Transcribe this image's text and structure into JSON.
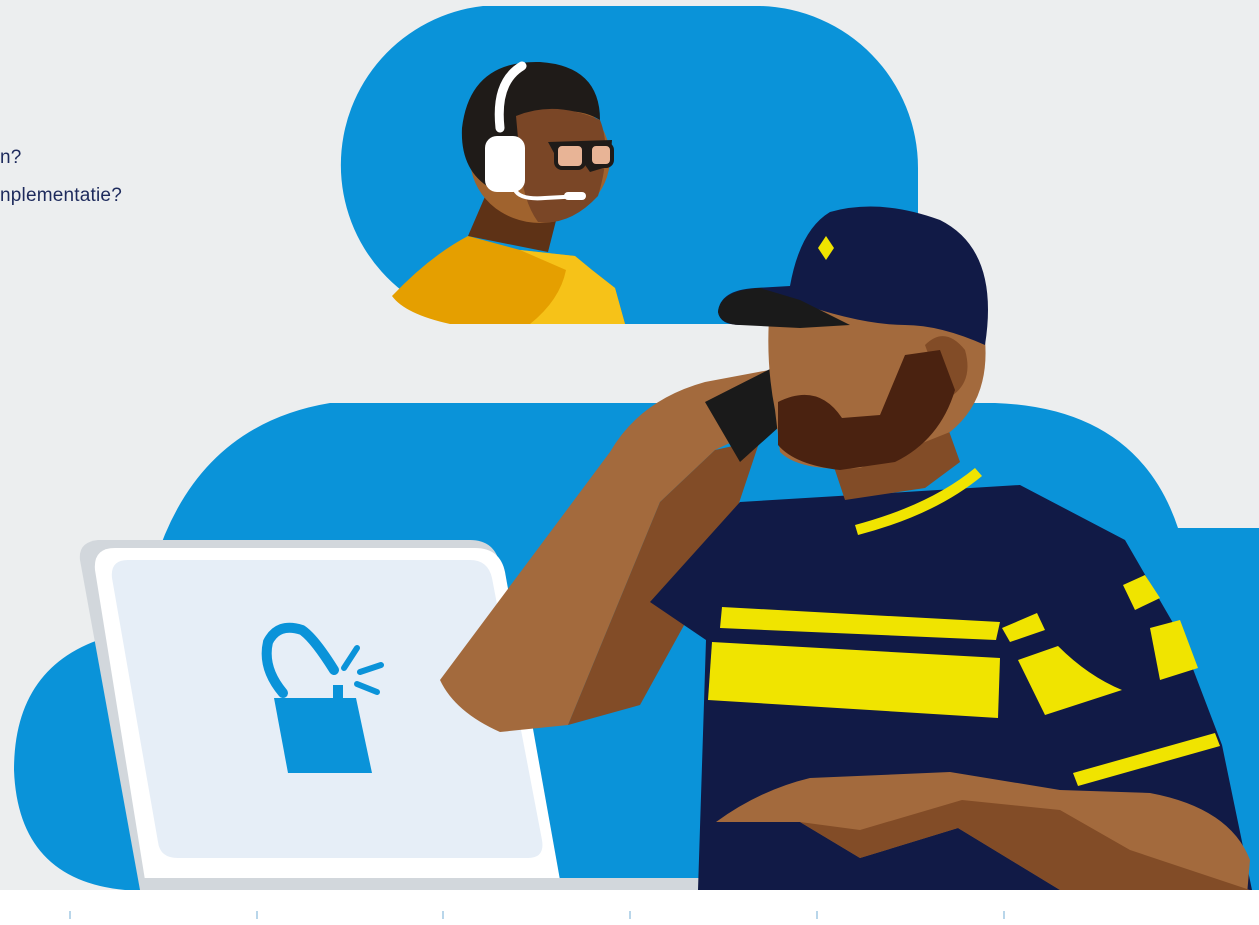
{
  "questions": [
    {
      "text": "n?"
    },
    {
      "text": "nplementatie?"
    }
  ],
  "colors": {
    "background": "#eceeef",
    "brand_blue": "#0a93d9",
    "navy": "#111a46",
    "yellow": "#f0e400",
    "text": "#1d2a5c"
  },
  "icons": {
    "support_agent": "headset-agent",
    "laptop_screen_icon": "shopping-bag-icon"
  }
}
